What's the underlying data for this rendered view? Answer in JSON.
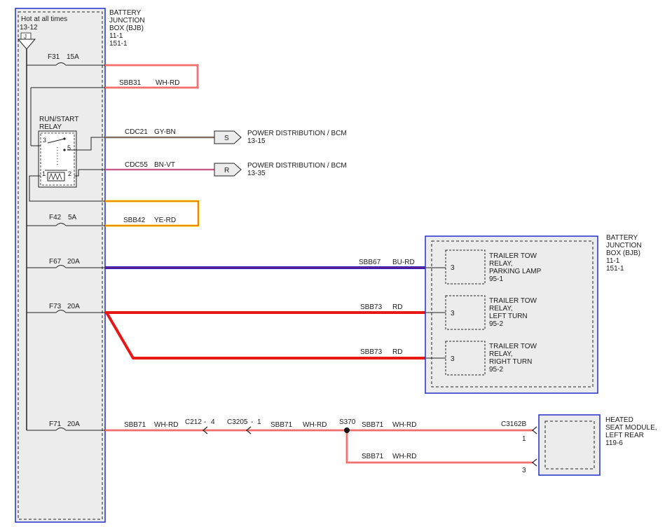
{
  "left_box": {
    "hot_label": "Hot at all times",
    "hot_ref": "13-12",
    "connector_j": "J",
    "title_lines": [
      "BATTERY",
      "JUNCTION",
      "BOX (BJB)",
      "11-1",
      "151-1"
    ]
  },
  "right_box": {
    "title_lines": [
      "BATTERY",
      "JUNCTION",
      "BOX (BJB)",
      "11-1",
      "151-1"
    ],
    "relays": [
      {
        "pin": "3",
        "lines": [
          "TRAILER TOW",
          "RELAY,",
          "PARKING LAMP",
          "95-1"
        ]
      },
      {
        "pin": "3",
        "lines": [
          "TRAILER TOW",
          "RELAY,",
          "LEFT TURN",
          "95-2"
        ]
      },
      {
        "pin": "3",
        "lines": [
          "TRAILER TOW",
          "RELAY,",
          "RIGHT TURN",
          "95-2"
        ]
      }
    ]
  },
  "fuses": [
    {
      "id": "F31",
      "rating": "15A"
    },
    {
      "id": "F42",
      "rating": "5A"
    },
    {
      "id": "F67",
      "rating": "20A"
    },
    {
      "id": "F73",
      "rating": "20A"
    },
    {
      "id": "F71",
      "rating": "20A"
    }
  ],
  "relay": {
    "title": [
      "RUN/START",
      "RELAY"
    ],
    "pins": [
      "3",
      "5",
      "1",
      "2"
    ]
  },
  "wires": {
    "sbb31": {
      "circuit": "SBB31",
      "color": "WH-RD"
    },
    "cdc21": {
      "circuit": "CDC21",
      "color": "GY-BN"
    },
    "cdc55": {
      "circuit": "CDC55",
      "color": "BN-VT"
    },
    "sbb42": {
      "circuit": "SBB42",
      "color": "YE-RD"
    },
    "sbb67": {
      "circuit": "SBB67",
      "color": "BU-RD"
    },
    "sbb73a": {
      "circuit": "SBB73",
      "color": "RD"
    },
    "sbb73b": {
      "circuit": "SBB73",
      "color": "RD"
    },
    "sbb71a": {
      "circuit": "SBB71",
      "color": "WH-RD"
    },
    "sbb71b": {
      "circuit": "SBB71",
      "color": "WH-RD"
    },
    "sbb71c": {
      "circuit": "SBB71",
      "color": "WH-RD"
    },
    "sbb71d": {
      "circuit": "SBB71",
      "color": "WH-RD"
    }
  },
  "destinations": [
    {
      "letter": "S",
      "line1": "POWER DISTRIBUTION / BCM",
      "line2": "13-15"
    },
    {
      "letter": "R",
      "line1": "POWER DISTRIBUTION / BCM",
      "line2": "13-35"
    }
  ],
  "connectors": {
    "c212": "C212",
    "c212_pin": "4",
    "c3205": "C3205",
    "c3205_pin": "1",
    "splice": "S370",
    "c3162b": "C3162B",
    "pin1": "1",
    "pin3": "3"
  },
  "heated_seat": {
    "lines": [
      "HEATED",
      "SEAT MODULE,",
      "LEFT REAR",
      "119-6"
    ]
  },
  "colors": {
    "frame_blue": "#1f2fc8",
    "wire_red": "#e81818",
    "wire_blue": "#2222c8",
    "wire_yellow": "#f0d000",
    "wire_gray": "#808080",
    "box_fill": "#ececec"
  }
}
